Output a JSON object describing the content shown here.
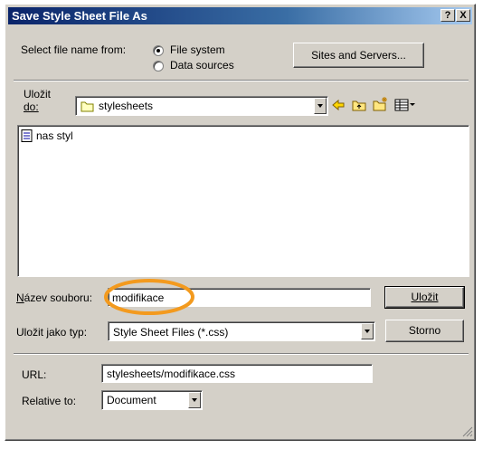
{
  "dialog": {
    "title": "Save Style Sheet File As",
    "help_label": "?",
    "close_label": "X"
  },
  "select_from": {
    "label": "Select file name from:",
    "options": [
      "File system",
      "Data sources"
    ],
    "selected": "File system"
  },
  "sites_button": "Sites and Servers...",
  "save_in": {
    "label_line1": "Uložit",
    "label_line2": "do:",
    "value": "stylesheets"
  },
  "files": [
    {
      "name": "nas styl"
    }
  ],
  "filename": {
    "label": "Název souboru:",
    "value": "modifikace"
  },
  "filetype": {
    "label": "Uložit jako typ:",
    "value": "Style Sheet Files (*.css)"
  },
  "buttons": {
    "save": "Uložit",
    "cancel": "Storno"
  },
  "url": {
    "label": "URL:",
    "value": "stylesheets/modifikace.css"
  },
  "relative": {
    "label": "Relative to:",
    "value": "Document"
  },
  "colors": {
    "highlight_ring": "#f39a1e",
    "title_bar": "#0a246a"
  }
}
